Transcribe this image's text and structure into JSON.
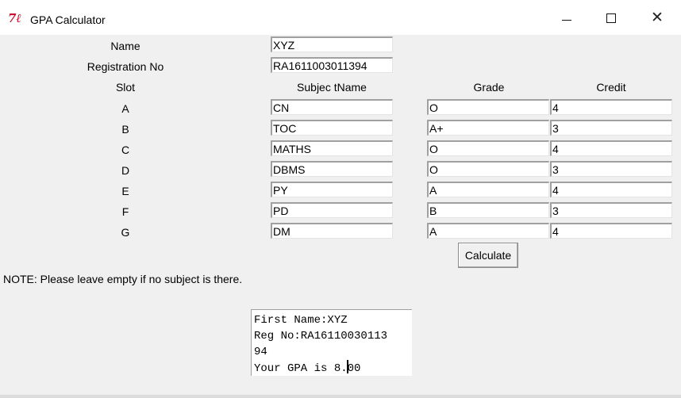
{
  "window": {
    "title": "GPA Calculator",
    "icon": "tk-feather-icon"
  },
  "form": {
    "name_label": "Name",
    "name_value": "XYZ",
    "reg_label": "Registration No",
    "reg_value": "RA1611003011394"
  },
  "headers": {
    "slot": "Slot",
    "subject": "Subjec tName",
    "grade": "Grade",
    "credit": "Credit"
  },
  "rows": [
    {
      "slot": "A",
      "subject": "CN",
      "grade": "O",
      "credit": "4"
    },
    {
      "slot": "B",
      "subject": "TOC",
      "grade": "A+",
      "credit": "3"
    },
    {
      "slot": "C",
      "subject": "MATHS",
      "grade": "O",
      "credit": "4"
    },
    {
      "slot": "D",
      "subject": "DBMS",
      "grade": "O",
      "credit": "3"
    },
    {
      "slot": "E",
      "subject": "PY",
      "grade": "A",
      "credit": "4"
    },
    {
      "slot": "F",
      "subject": "PD",
      "grade": "B",
      "credit": "3"
    },
    {
      "slot": "G",
      "subject": "DM",
      "grade": "A",
      "credit": "4"
    }
  ],
  "calculate_label": "Calculate",
  "note": "NOTE: Please leave empty if no subject is there.",
  "output": {
    "line1": "First Name:XYZ",
    "line2": "Reg No:RA16110030113",
    "line3": "94",
    "line4_before_caret": "Your GPA is 8.",
    "line4_after_caret": "00"
  }
}
